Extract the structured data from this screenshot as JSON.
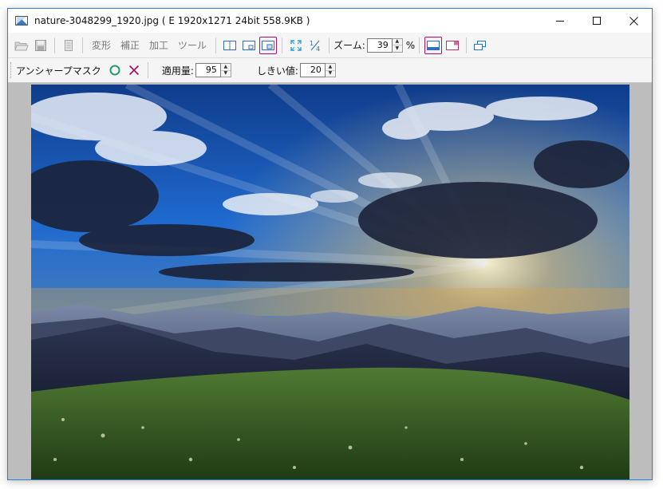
{
  "window": {
    "title": "nature-3048299_1920.jpg ( E  1920x1271  24bit  558.9KB )"
  },
  "toolbar": {
    "menu_transform": "変形",
    "menu_correct": "補正",
    "menu_process": "加工",
    "menu_tools": "ツール",
    "zoom_label": "ズーム:",
    "zoom_value": "39",
    "zoom_unit": "%"
  },
  "filter_bar": {
    "title": "アンシャープマスク",
    "amount_label": "適用量:",
    "amount_value": "95",
    "threshold_label": "しきい値:",
    "threshold_value": "20"
  },
  "colors": {
    "accent_border": "#2b7fd7",
    "active_button_border": "#b0126e",
    "ok_circle": "#2a9a6e",
    "cancel_x": "#a0125e"
  }
}
